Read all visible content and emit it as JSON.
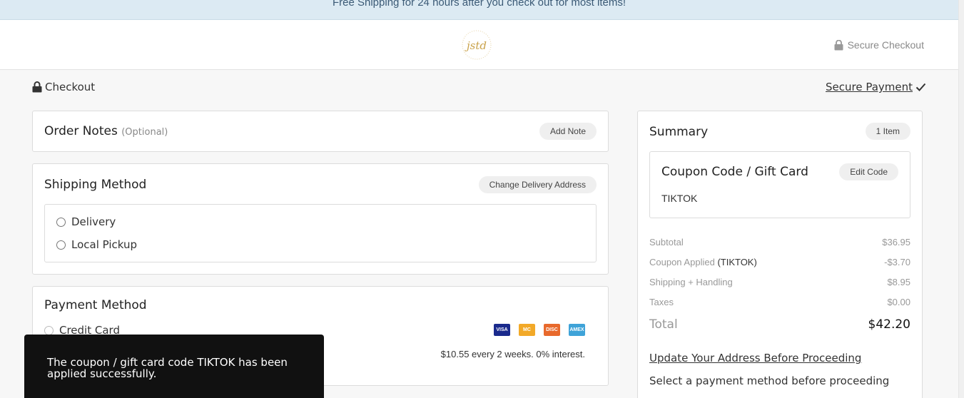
{
  "banner": {
    "text": "Free Shipping for 24 hours after you check out for most items!"
  },
  "header": {
    "logo_text": "jstd",
    "secure_checkout": "Secure Checkout"
  },
  "page": {
    "checkout_label": "Checkout",
    "secure_payment": "Secure Payment"
  },
  "order_notes": {
    "title": "Order Notes",
    "optional": "(Optional)",
    "add_note": "Add Note"
  },
  "shipping": {
    "title": "Shipping Method",
    "change_address": "Change Delivery Address",
    "options": [
      "Delivery",
      "Local Pickup"
    ]
  },
  "payment": {
    "title": "Payment Method",
    "credit_card": "Credit Card",
    "card_brands": [
      "VISA",
      "MC",
      "DISC",
      "AMEX"
    ],
    "installment_text": "$10.55 every 2 weeks. 0% interest."
  },
  "summary": {
    "title": "Summary",
    "item_count": "1 Item",
    "coupon": {
      "title": "Coupon Code / Gift Card",
      "edit": "Edit Code",
      "code": "TIKTOK"
    },
    "lines": {
      "subtotal_label": "Subtotal",
      "subtotal_value": "$36.95",
      "coupon_label": "Coupon Applied",
      "coupon_code": "(TIKTOK)",
      "coupon_value": "-$3.70",
      "shipping_label": "Shipping + Handling",
      "shipping_value": "$8.95",
      "taxes_label": "Taxes",
      "taxes_value": "$0.00"
    },
    "total_label": "Total",
    "total_value": "$42.20",
    "update_address": "Update Your Address Before Proceeding",
    "select_payment": "Select a payment method before proceeding"
  },
  "toast": {
    "message": "The coupon / gift card code TIKTOK has been applied successfully."
  },
  "colors": {
    "banner_bg": "#dceaf3",
    "toast_bg": "#111111",
    "logo_gold": "#c9a24a"
  }
}
